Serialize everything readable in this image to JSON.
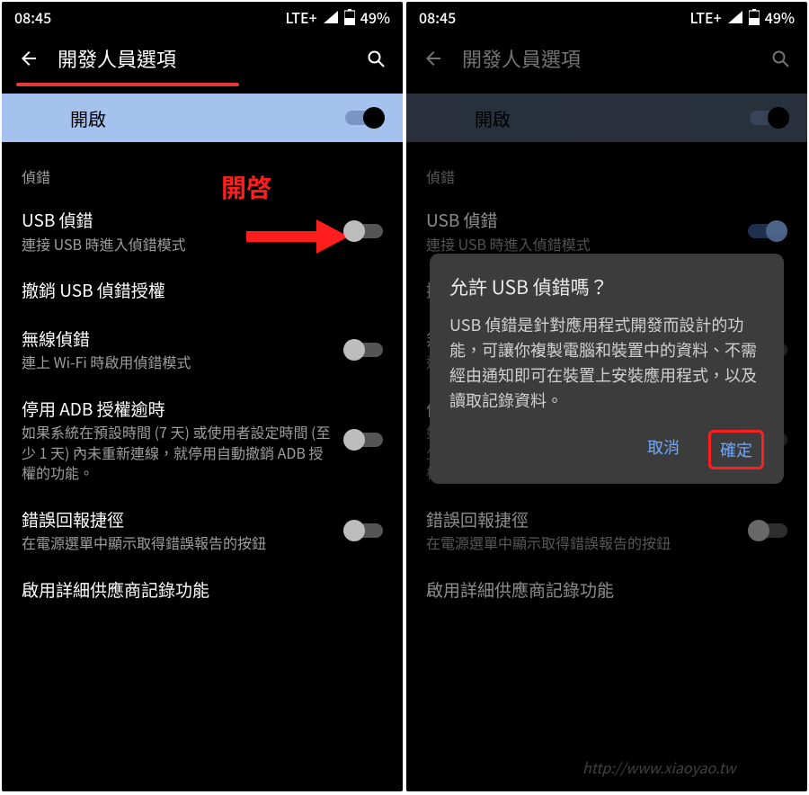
{
  "status": {
    "time": "08:45",
    "network": "LTE+",
    "battery_text": "49%"
  },
  "header": {
    "title": "開發人員選項"
  },
  "enable": {
    "label": "開啟"
  },
  "section": {
    "debug": "偵錯"
  },
  "settings": {
    "usb_debug": {
      "title": "USB 偵錯",
      "sub": "連接 USB 時進入偵錯模式"
    },
    "revoke_usb": {
      "title": "撤銷 USB 偵錯授權"
    },
    "wireless_debug": {
      "title": "無線偵錯",
      "sub": "連上 Wi-Fi 時啟用偵錯模式"
    },
    "adb_timeout": {
      "title": "停用 ADB 授權逾時",
      "sub": "如果系統在預設時間 (7 天) 或使用者設定時間 (至少 1 天) 內未重新連線，就停用自動撤銷 ADB 授權的功能。"
    },
    "bugreport": {
      "title": "錯誤回報捷徑",
      "sub": "在電源選單中顯示取得錯誤報告的按鈕"
    },
    "verbose_vendor": {
      "title": "啟用詳細供應商記錄功能"
    }
  },
  "annotation": {
    "open": "開啓"
  },
  "dialog": {
    "title": "允許 USB 偵錯嗎？",
    "body": "USB 偵錯是針對應用程式開發而設計的功能，可讓你複製電腦和裝置中的資料、不需經由通知即可在裝置上安裝應用程式，以及讀取記錄資料。",
    "cancel": "取消",
    "ok": "確定"
  },
  "watermark": {
    "url": "http://www.xiaoyao.tw"
  }
}
